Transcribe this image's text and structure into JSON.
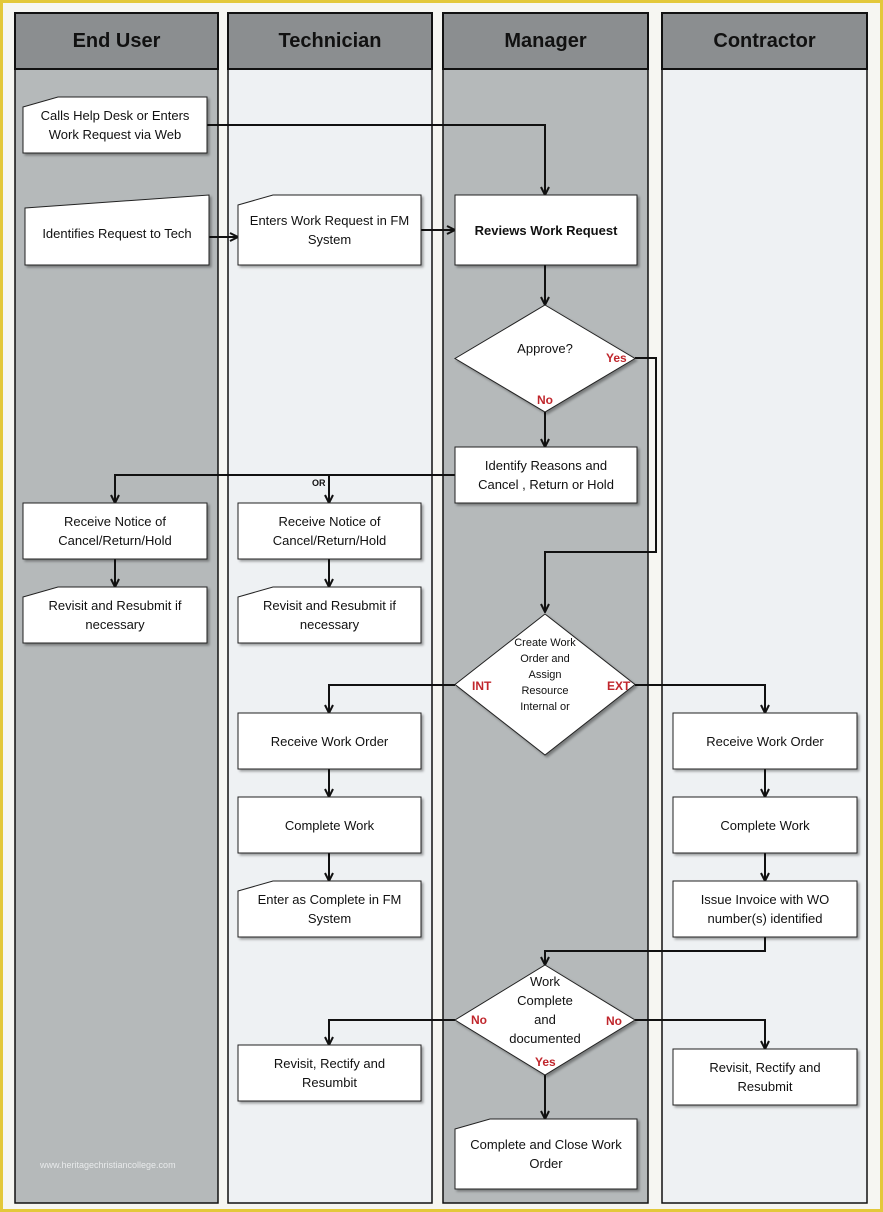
{
  "lanes": [
    {
      "id": "end-user",
      "title": "End User",
      "fill": "#b5b9ba"
    },
    {
      "id": "technician",
      "title": "Technician",
      "fill": "#eef1f3"
    },
    {
      "id": "manager",
      "title": "Manager",
      "fill": "#b5b9ba"
    },
    {
      "id": "contractor",
      "title": "Contractor",
      "fill": "#eef1f3"
    }
  ],
  "colors": {
    "header": "#8b8e90",
    "border": "#e3c83a",
    "label_red": "#c0262c"
  },
  "nodes": [
    {
      "id": "calls-help-desk",
      "text": "Calls Help Desk or Enters Work Request via Web",
      "shape": "manual"
    },
    {
      "id": "identifies-request",
      "text": "Identifies Request to Tech",
      "shape": "slant"
    },
    {
      "id": "enters-work-request",
      "text": "Enters Work Request in FM System",
      "shape": "manual"
    },
    {
      "id": "reviews-work-request",
      "text": "Reviews Work Request",
      "shape": "rect",
      "bold": true
    },
    {
      "id": "approve",
      "text": "Approve?",
      "shape": "diamond"
    },
    {
      "id": "identify-reasons",
      "text": "Identify Reasons and Cancel , Return or Hold",
      "shape": "rect"
    },
    {
      "id": "eu-receive-notice",
      "text": "Receive Notice of Cancel/Return/Hold",
      "shape": "rect"
    },
    {
      "id": "tech-receive-notice",
      "text": "Receive Notice of Cancel/Return/Hold",
      "shape": "rect"
    },
    {
      "id": "eu-revisit",
      "text": "Revisit and Resubmit if necessary",
      "shape": "manual"
    },
    {
      "id": "tech-revisit",
      "text": "Revisit and Resubmit if necessary",
      "shape": "manual"
    },
    {
      "id": "create-work-order",
      "text": "Create Work Order and Assign Resource Internal or",
      "shape": "diamond"
    },
    {
      "id": "tech-receive-wo",
      "text": "Receive Work Order",
      "shape": "rect"
    },
    {
      "id": "con-receive-wo",
      "text": "Receive Work Order",
      "shape": "rect"
    },
    {
      "id": "tech-complete-work",
      "text": "Complete Work",
      "shape": "rect"
    },
    {
      "id": "con-complete-work",
      "text": "Complete Work",
      "shape": "rect"
    },
    {
      "id": "enter-complete",
      "text": "Enter as Complete in FM System",
      "shape": "manual"
    },
    {
      "id": "issue-invoice",
      "text": "Issue Invoice with WO number(s) identified",
      "shape": "rect"
    },
    {
      "id": "work-complete",
      "text": "Work Complete and documented",
      "shape": "diamond"
    },
    {
      "id": "tech-rectify",
      "text": "Revisit, Rectify and Resumbit",
      "shape": "rect"
    },
    {
      "id": "con-rectify",
      "text": "Revisit,  Rectify and Resubmit",
      "shape": "rect"
    },
    {
      "id": "close-work-order",
      "text": "Complete and Close Work Order",
      "shape": "manual"
    }
  ],
  "branch_labels": {
    "approve_yes": "Yes",
    "approve_no": "No",
    "or": "OR",
    "int": "INT",
    "ext": "EXT",
    "complete_no_left": "No",
    "complete_no_right": "No",
    "complete_yes": "Yes"
  },
  "watermark": "www.heritagechristiancollege.com"
}
